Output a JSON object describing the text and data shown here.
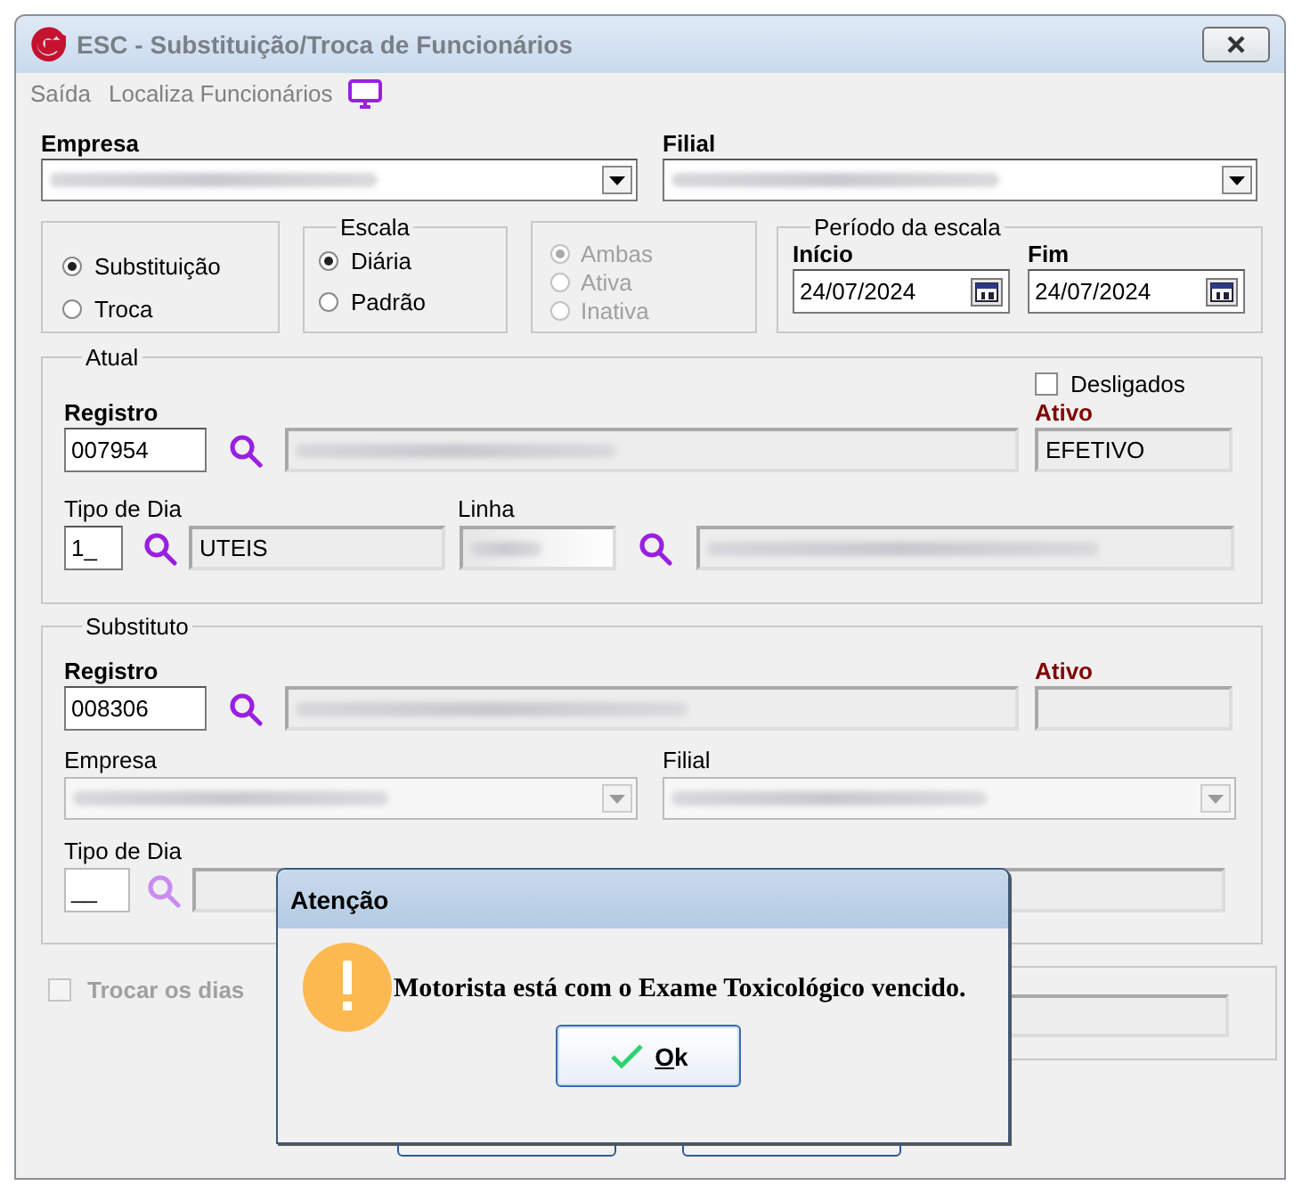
{
  "window": {
    "title": "ESC - Substituição/Troca de Funcionários"
  },
  "menu": [
    {
      "label": "Saída"
    },
    {
      "label": "Localiza Funcionários"
    }
  ],
  "header": {
    "empresa_label": "Empresa",
    "filial_label": "Filial"
  },
  "mode": [
    {
      "label": "Substituição",
      "selected": true
    },
    {
      "label": "Troca",
      "selected": false
    }
  ],
  "escala": {
    "title": "Escala",
    "options": [
      {
        "label": "Diária",
        "selected": true
      },
      {
        "label": "Padrão",
        "selected": false
      }
    ]
  },
  "status_filter": {
    "disabled": true,
    "options": [
      {
        "label": "Ambas",
        "selected": true
      },
      {
        "label": "Ativa",
        "selected": false
      },
      {
        "label": "Inativa",
        "selected": false
      }
    ]
  },
  "periodo": {
    "title": "Período da escala",
    "inicio_label": "Início",
    "inicio": "24/07/2024",
    "fim_label": "Fim",
    "fim": "24/07/2024"
  },
  "atual": {
    "title": "Atual",
    "desligados": {
      "label": "Desligados",
      "checked": false
    },
    "registro_label": "Registro",
    "registro": "007954",
    "ativo_label": "Ativo",
    "ativo": "EFETIVO",
    "tipo_dia_label": "Tipo de Dia",
    "tipo_dia": "1_",
    "tipo_dia_desc": "UTEIS",
    "linha_label": "Linha"
  },
  "substituto": {
    "title": "Substituto",
    "registro_label": "Registro",
    "registro": "008306",
    "ativo_label": "Ativo",
    "empresa_label": "Empresa",
    "filial_label": "Filial",
    "tipo_dia_label": "Tipo de Dia",
    "tipo_dia": "__"
  },
  "trocar_dias": {
    "label": "Trocar os dias",
    "checked": false,
    "disabled": true
  },
  "dialog": {
    "title": "Atenção",
    "message": "Motorista está com o Exame Toxicológico vencido.",
    "button": "Ok"
  }
}
